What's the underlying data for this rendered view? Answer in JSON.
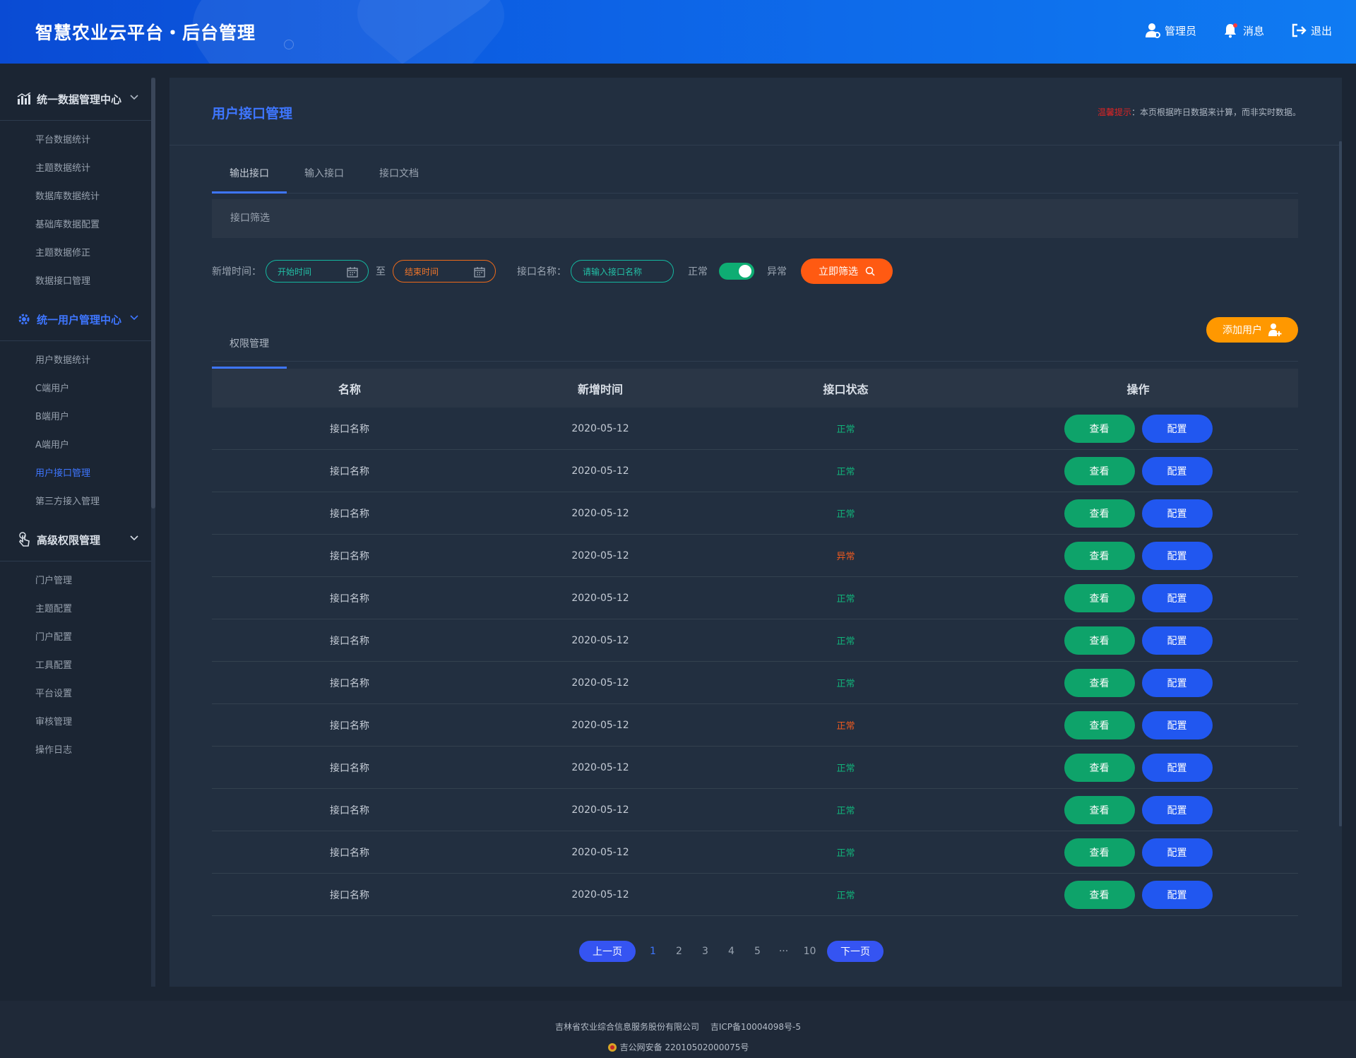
{
  "header": {
    "brand": "智慧农业云平台・后台管理",
    "admin": "管理员",
    "messages": "消息",
    "logout": "退出"
  },
  "sidebar": {
    "groups": [
      {
        "title": "统一数据管理中心",
        "items": [
          "平台数据统计",
          "主题数据统计",
          "数据库数据统计",
          "基础库数据配置",
          "主题数据修正",
          "数据接口管理"
        ]
      },
      {
        "title": "统一用户管理中心",
        "items": [
          "用户数据统计",
          "C端用户",
          "B端用户",
          "A端用户",
          "用户接口管理",
          "第三方接入管理"
        ]
      },
      {
        "title": "高级权限管理",
        "items": [
          "门户管理",
          "主题配置",
          "门户配置",
          "工具配置",
          "平台设置",
          "审核管理",
          "操作日志"
        ]
      }
    ]
  },
  "page": {
    "title": "用户接口管理",
    "tip_label": "温馨提示",
    "tip_text": "：本页根据昨日数据来计算，而非实时数据。"
  },
  "tabs": [
    "输出接口",
    "输入接口",
    "接口文档"
  ],
  "filter": {
    "section_title": "接口筛选",
    "time_label": "新增时间：",
    "start_placeholder": "开始时间",
    "to": "至",
    "end_placeholder": "结束时间",
    "name_label": "接口名称：",
    "name_placeholder": "请输入接口名称",
    "normal": "正常",
    "abnormal": "异常",
    "submit": "立即筛选"
  },
  "permission": {
    "tab": "权限管理",
    "add_user": "添加用户"
  },
  "table": {
    "headers": [
      "名称",
      "新增时间",
      "接口状态",
      "操作"
    ],
    "view_label": "查看",
    "config_label": "配置",
    "rows": [
      {
        "name": "接口名称",
        "date": "2020-05-12",
        "status": "正常",
        "kind": "ok"
      },
      {
        "name": "接口名称",
        "date": "2020-05-12",
        "status": "正常",
        "kind": "ok"
      },
      {
        "name": "接口名称",
        "date": "2020-05-12",
        "status": "正常",
        "kind": "ok"
      },
      {
        "name": "接口名称",
        "date": "2020-05-12",
        "status": "异常",
        "kind": "bad"
      },
      {
        "name": "接口名称",
        "date": "2020-05-12",
        "status": "正常",
        "kind": "ok"
      },
      {
        "name": "接口名称",
        "date": "2020-05-12",
        "status": "正常",
        "kind": "ok"
      },
      {
        "name": "接口名称",
        "date": "2020-05-12",
        "status": "正常",
        "kind": "ok"
      },
      {
        "name": "接口名称",
        "date": "2020-05-12",
        "status": "正常",
        "kind": "bad"
      },
      {
        "name": "接口名称",
        "date": "2020-05-12",
        "status": "正常",
        "kind": "ok"
      },
      {
        "name": "接口名称",
        "date": "2020-05-12",
        "status": "正常",
        "kind": "ok"
      },
      {
        "name": "接口名称",
        "date": "2020-05-12",
        "status": "正常",
        "kind": "ok"
      },
      {
        "name": "接口名称",
        "date": "2020-05-12",
        "status": "正常",
        "kind": "ok"
      }
    ]
  },
  "pagination": {
    "prev": "上一页",
    "pages": [
      "1",
      "2",
      "3",
      "4",
      "5",
      "···",
      "10"
    ],
    "next": "下一页"
  },
  "footer": {
    "company": "吉林省农业综合信息服务股份有限公司",
    "icp": "吉ICP备10004098号-5",
    "police": "吉公网安备 22010502000075号"
  },
  "colors": {
    "accent": "#3e76ff",
    "view": "#0ea36a",
    "config": "#2157f0",
    "filter": "#ff5a12",
    "add": "#ff9800",
    "ok": "#11b37a",
    "bad": "#ef5a1f"
  },
  "icons": [
    "admin-icon",
    "bell-icon",
    "logout-icon",
    "chart-icon",
    "gear-icon",
    "finger-icon",
    "chevron-down-icon",
    "calendar-icon",
    "search-icon",
    "add-user-icon",
    "police-badge-icon"
  ]
}
